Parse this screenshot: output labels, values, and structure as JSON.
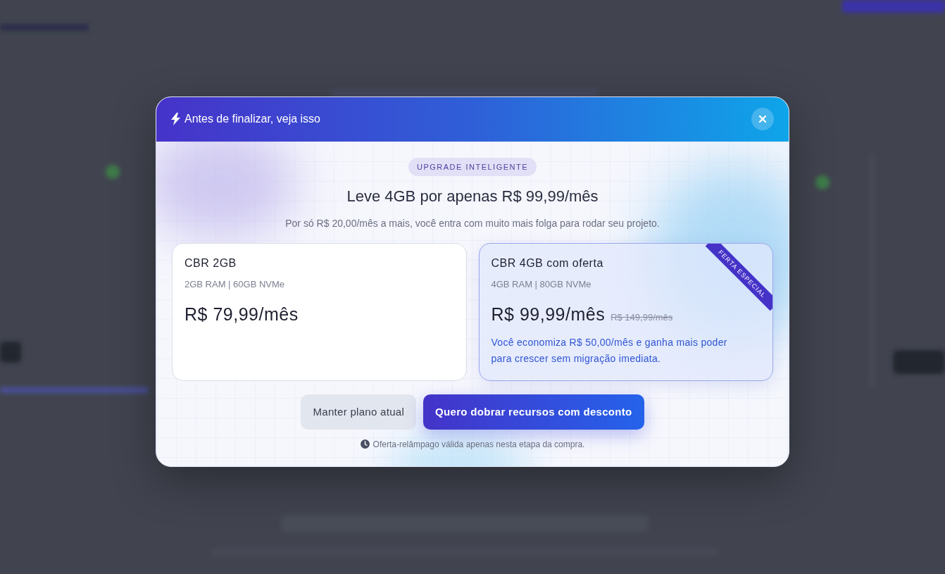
{
  "dialog": {
    "title": "Antes de finalizar, veja isso",
    "badge": "UPGRADE INTELIGENTE",
    "headline": "Leve 4GB por apenas R$ 99,99/mês",
    "subtitle": "Por só R$ 20,00/mês a mais, você entra com muito mais folga para rodar seu projeto.",
    "plans": [
      {
        "kind": "current",
        "selected": false,
        "name": "CBR 2GB",
        "specs": "2GB RAM | 60GB NVMe",
        "price": "R$ 79,99/mês"
      },
      {
        "kind": "offer",
        "selected": true,
        "name": "CBR 4GB com oferta",
        "specs": "4GB RAM | 80GB NVMe",
        "price": "R$ 99,99/mês",
        "old_price": "R$ 149,99/mês",
        "savings": "Você economiza R$ 50,00/mês e ganha mais poder para crescer sem migração imediata.",
        "ribbon": "FERTA ESPECIAL"
      }
    ],
    "buttons": [
      {
        "kind": "secondary",
        "label": "Manter plano atual"
      },
      {
        "kind": "primary",
        "label": "Quero dobrar recursos com desconto"
      }
    ],
    "note": "Oferta-relâmpago válida apenas nesta etapa da compra."
  }
}
